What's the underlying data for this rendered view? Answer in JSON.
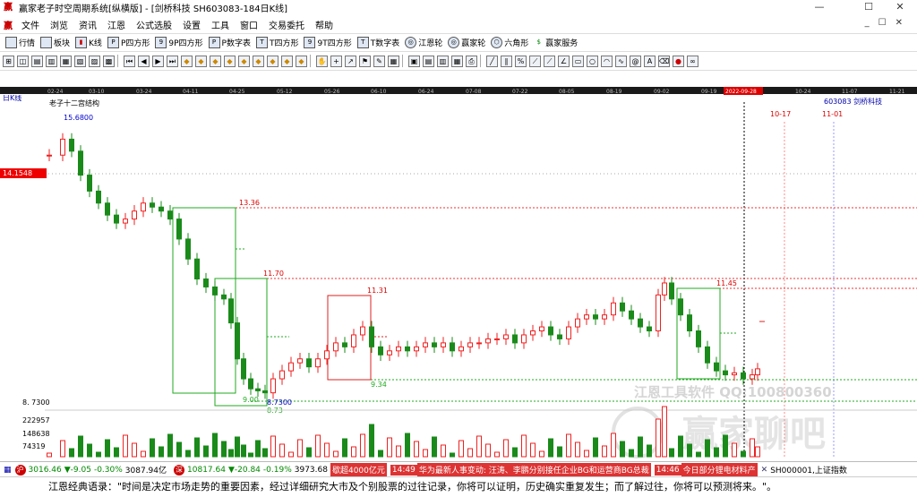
{
  "window": {
    "title": "赢家老子时空周期系统[纵横版] - [剑桥科技  SH603083-184日K线]"
  },
  "menu": [
    "文件",
    "浏览",
    "资讯",
    "江恩",
    "公式选股",
    "设置",
    "工具",
    "窗口",
    "交易委托",
    "帮助"
  ],
  "toolbar": [
    {
      "icon": "grid-icon",
      "label": "行情"
    },
    {
      "icon": "blocks-icon",
      "label": "板块"
    },
    {
      "icon": "candle-icon",
      "label": "K线"
    },
    {
      "icon": "p-icon",
      "label": "P四方形"
    },
    {
      "icon": "p9-icon",
      "label": "9P四方形"
    },
    {
      "icon": "pn-icon",
      "label": "P数字表"
    },
    {
      "icon": "t-icon",
      "label": "T四方形"
    },
    {
      "icon": "t9-icon",
      "label": "9T四方形"
    },
    {
      "icon": "tn-icon",
      "label": "T数字表"
    },
    {
      "icon": "wheel-icon",
      "label": "江恩轮"
    },
    {
      "icon": "wheel2-icon",
      "label": "赢家轮"
    },
    {
      "icon": "hexagon-icon",
      "label": "六角形"
    },
    {
      "icon": "dollar-icon",
      "label": "赢家服务"
    }
  ],
  "chart_header": {
    "period": "日K线",
    "structure": "老子十二宫结构",
    "stock_label": "603083 剑桥科技",
    "price_marker": "14.1548",
    "cursor_date": "2022-09-28"
  },
  "date_axis": [
    "02-24",
    "03-10",
    "03-24",
    "04-11",
    "04-25",
    "05-12",
    "05-26",
    "06-10",
    "06-24",
    "07-08",
    "07-22",
    "08-05",
    "08-19",
    "09-02",
    "09-19",
    "2022-09-28",
    "10-24",
    "11-07",
    "11-21"
  ],
  "future_dates": [
    "10-17",
    "11-01"
  ],
  "chart_data": {
    "type": "candlestick",
    "title": "剑桥科技",
    "price_levels": {
      "high_marker": 15.68,
      "box1_top": 13.36,
      "box2_top": 11.7,
      "box3_top": 11.31,
      "box3_bottom": 9.34,
      "box4_top": 11.45,
      "low_marker": 8.73,
      "low2": 8.73,
      "box1_bottom": 9.0
    },
    "volume_axis": [
      "222957",
      "148638",
      "74319"
    ],
    "price_axis_low": "8. 7300"
  },
  "labels": {
    "high": "15.6800",
    "l1336": "13.36",
    "l1170": "11.70",
    "l1131": "11.31",
    "l934": "9.34",
    "l1145": "11.45",
    "l900": "9.00",
    "l873": "8.73",
    "l8730": "8.7300"
  },
  "watermark": {
    "line1": "江恩工具软件 QQ:100800360",
    "line2": "赢家聊吧"
  },
  "status": {
    "sh_index": "3016.46",
    "sh_change": "▼-9.05",
    "sh_pct": "-0.30%",
    "sh_amount": "3087.94亿",
    "sz_index": "10817.64",
    "sz_change": "▼-20.84",
    "sz_pct": "-0.19%",
    "sz_amount": "3973.68",
    "ticker1": "歇超4000亿元",
    "time1": "14:49",
    "news1": "华为最新人事变动: 汪涛、李鹏分别接任企业BG和运营商BG总裁",
    "time2": "14:46",
    "news2": "今日部分锂电材料产",
    "code": "SH000001,上证指数"
  },
  "quote": "江恩经典语录：\"时间是决定市场走势的重要因素，经过详细研究大市及个别股票的过往记录，你将可以证明，历史确实重复发生；而了解过往，你将可以预测将来。\"。"
}
